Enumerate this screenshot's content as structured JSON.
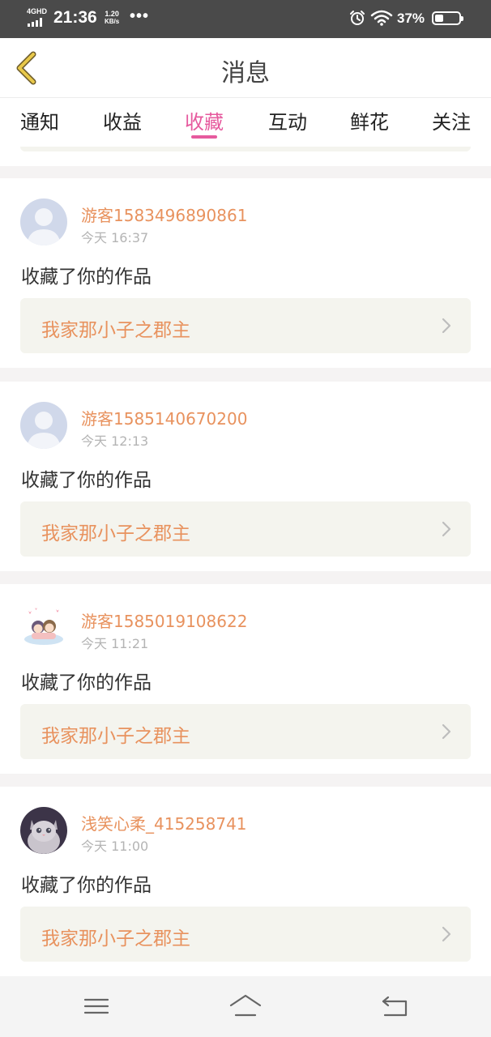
{
  "status_bar": {
    "network": "4GHD",
    "time": "21:36",
    "speed_value": "1.20",
    "speed_unit": "KB/s",
    "more": "•••",
    "battery_percent": "37%",
    "battery_level": 0.37
  },
  "header": {
    "title": "消息",
    "back_icon": "back-chevron-icon"
  },
  "tabs": [
    {
      "label": "通知",
      "active": false
    },
    {
      "label": "收益",
      "active": false
    },
    {
      "label": "收藏",
      "active": true
    },
    {
      "label": "互动",
      "active": false
    },
    {
      "label": "鲜花",
      "active": false
    },
    {
      "label": "关注",
      "active": false
    }
  ],
  "messages": [
    {
      "username": "游客1583496890861",
      "time": "今天 16:37",
      "action": "收藏了你的作品",
      "work_title": "我家那小子之郡主",
      "avatar": "default-avatar"
    },
    {
      "username": "游客1585140670200",
      "time": "今天 12:13",
      "action": "收藏了你的作品",
      "work_title": "我家那小子之郡主",
      "avatar": "default-avatar"
    },
    {
      "username": "游客1585019108622",
      "time": "今天 11:21",
      "action": "收藏了你的作品",
      "work_title": "我家那小子之郡主",
      "avatar": "cartoon-couple-avatar"
    },
    {
      "username": "浅笑心柔_415258741",
      "time": "今天 11:00",
      "action": "收藏了你的作品",
      "work_title": "我家那小子之郡主",
      "avatar": "kitten-photo-avatar"
    }
  ],
  "nav_bar": {
    "menu_icon": "menu-icon",
    "home_icon": "home-icon",
    "back_icon": "back-icon"
  },
  "colors": {
    "accent_pink": "#e65a9e",
    "username_orange": "#e8925e",
    "card_link_bg": "#f4f4ee",
    "back_chevron": "#e8c84a"
  }
}
